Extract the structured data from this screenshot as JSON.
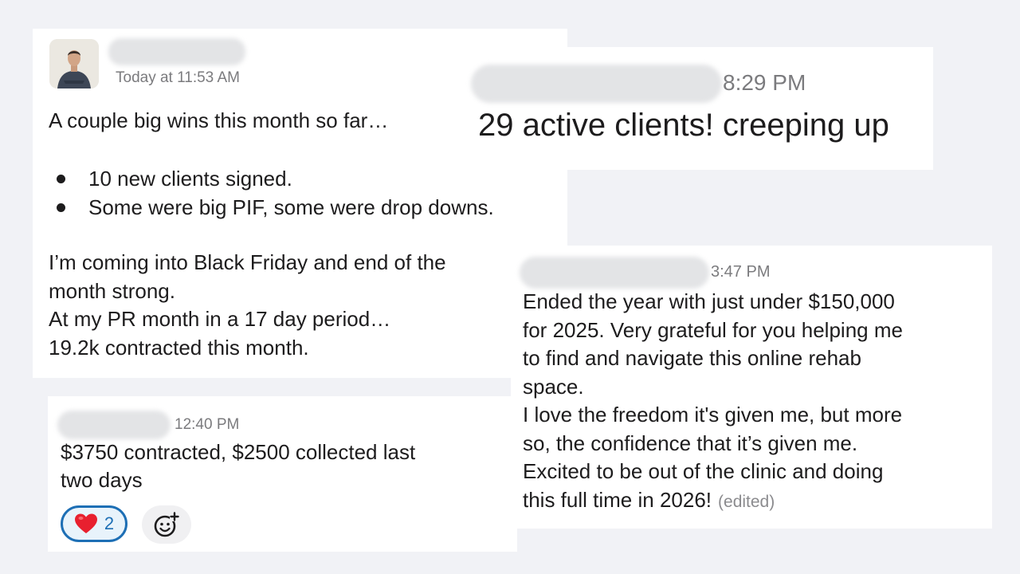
{
  "messages": [
    {
      "time": "Today at 11:53 AM",
      "intro": "A couple big wins this month so far…",
      "bullets": [
        "10 new clients signed.",
        "Some were big PIF, some were drop downs."
      ],
      "body_lines": [
        "I’m coming into Black Friday and end of the",
        "month strong.",
        "At my PR month in a 17 day period…",
        "19.2k contracted this month."
      ]
    },
    {
      "time": "8:29 PM",
      "text": "29 active clients! creeping up"
    },
    {
      "time": "3:47 PM",
      "body_lines": [
        "Ended the year with just under $150,000",
        "for 2025. Very grateful for you helping me",
        "to find and navigate this online rehab",
        "space.",
        "I love the freedom it's given me, but more",
        "so, the confidence that it’s given me.",
        "Excited to be out of the clinic and doing",
        "this full time in 2026!"
      ],
      "edited_label": "(edited)"
    },
    {
      "time": "12:40 PM",
      "body_lines": [
        "$3750 contracted, $2500 collected last",
        "two days"
      ],
      "reaction": {
        "emoji": "❤️",
        "count": "2"
      },
      "add_reaction_icon": "add-reaction-icon"
    }
  ],
  "colors": {
    "background": "#f1f2f6",
    "card": "#ffffff",
    "timestamp": "#7b7b7e",
    "reaction_border": "#1d6fb5"
  }
}
